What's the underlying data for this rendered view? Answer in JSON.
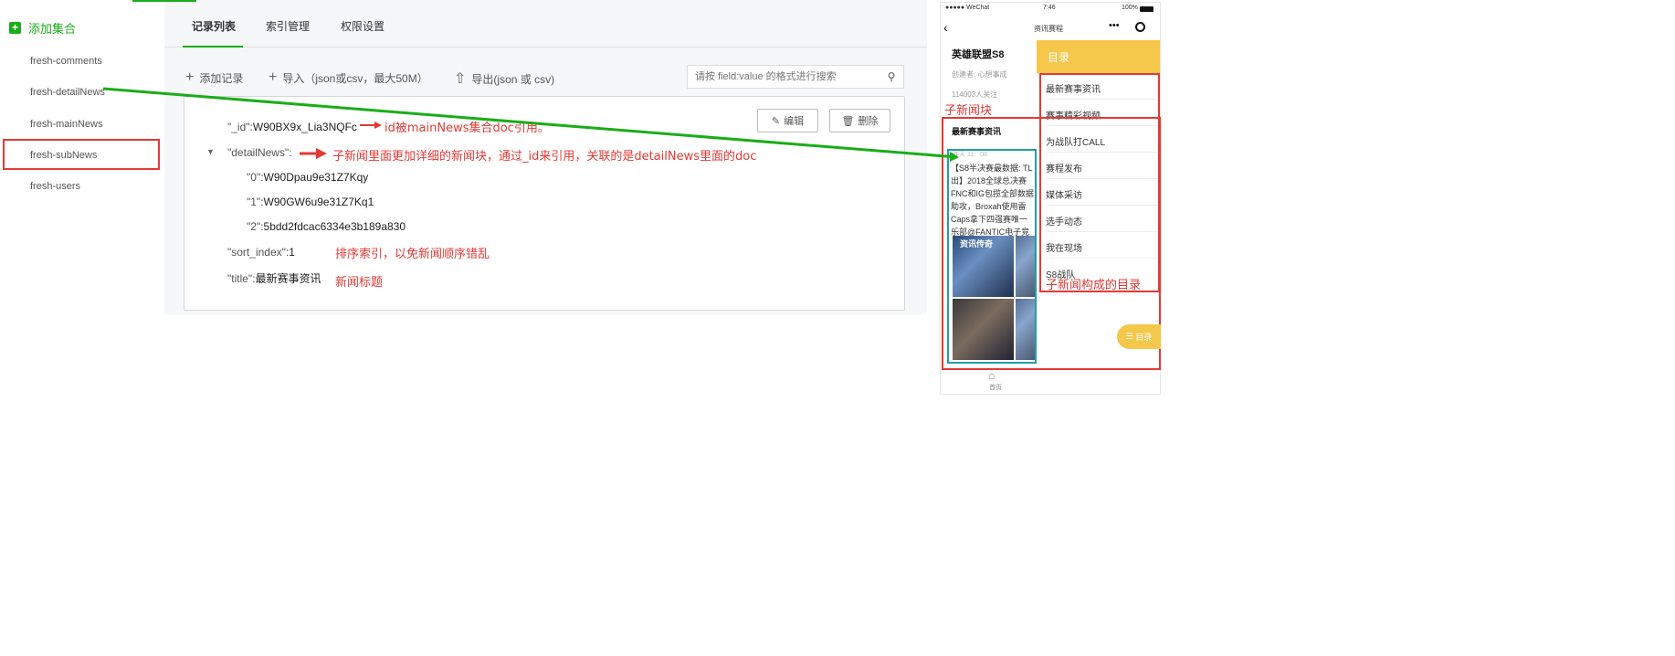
{
  "sidebar": {
    "add_label": "添加集合",
    "collections": [
      "fresh-comments",
      "fresh-detailNews",
      "fresh-mainNews",
      "fresh-subNews",
      "fresh-users"
    ]
  },
  "tabs": [
    "记录列表",
    "索引管理",
    "权限设置"
  ],
  "toolbar": {
    "add_record": "添加记录",
    "import": "导入（json或csv，最大50M）",
    "export": "导出(json 或 csv)",
    "search_placeholder": "请按 field:value 的格式进行搜索"
  },
  "record": {
    "edit_label": "编辑",
    "delete_label": "删除",
    "id_key": "\"_id\":",
    "id_value": "W90BX9x_Lia3NQFc",
    "detail_key": "\"detailNews\":",
    "detail_items": [
      {
        "key": "\"0\":",
        "value": "W90Dpau9e31Z7Kqy"
      },
      {
        "key": "\"1\":",
        "value": "W90GW6u9e31Z7Kq1"
      },
      {
        "key": "\"2\":",
        "value": "5bdd2fdcac6334e3b189a830"
      }
    ],
    "sort_key": "\"sort_index\":",
    "sort_value": "1",
    "title_key": "\"title\":",
    "title_value": "最新赛事资讯"
  },
  "annotations": {
    "id_note": "id被mainNews集合doc引用。",
    "detail_note": "子新闻里面更加详细的新闻块，通过_id来引用，关联的是detailNews里面的doc",
    "sort_note": "排序索引，以免新闻顺序错乱",
    "title_note": "新闻标题",
    "sub_block_note": "子新闻块",
    "toc_note": "子新闻构成的目录"
  },
  "phone": {
    "status_left": "●●●●● WeChat",
    "status_time": "7:46",
    "status_battery": "100%",
    "nav_title": "资讯赛程",
    "page_title": "英雄联盟S8",
    "creator": "创建者: 心想事成",
    "followers": "114003人关注",
    "section_title": "最新赛事资讯",
    "time": "昨天 11：08",
    "body_lines": [
      "【S8半决赛最数据: TL",
      "出】2018全球总决赛",
      "FNC和IG包揽全部数据",
      "助攻，Broxah使用雷",
      "Caps拿下四强赛唯一",
      "乐部@FANTIC电子竞"
    ],
    "toc_title": "目录",
    "toc_items": [
      "最新赛事资讯",
      "赛事精彩视频",
      "为战队打CALL",
      "赛程发布",
      "媒体采访",
      "选手动态",
      "我在现场",
      "S8战队"
    ],
    "fab_label": "目录",
    "home_label": "首页",
    "thumb_caption": "资讯传奇"
  },
  "colors": {
    "accent_green": "#1aad19",
    "annotation_red": "#e53935",
    "toc_yellow": "#f5c84c",
    "teal": "#20a0a0"
  }
}
